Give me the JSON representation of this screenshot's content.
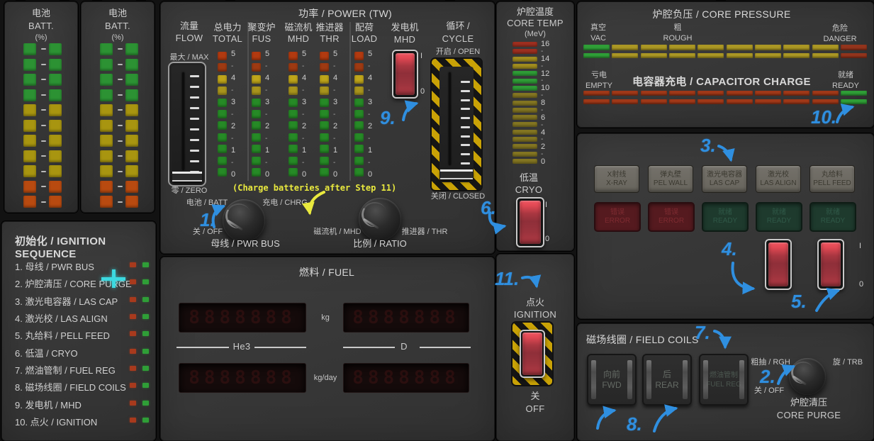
{
  "palette": {
    "g": "#2c9233",
    "y": "#a89510",
    "o": "#b84a10",
    "r1": "#b23a10",
    "r2": "#9e3a12",
    "y1": "#bfa51a",
    "y2": "#a8941c",
    "pg": "#268a26",
    "tr": "#a03020",
    "ty": "#a38f1f",
    "tg": "#2f9e37",
    "td": "#857722",
    "cg": "#2f9e37",
    "cy": "#ab9724",
    "cr": "#93341c",
    "qr": "#a03818",
    "qg": "#2f9e37"
  },
  "led_arrays": {
    "battery_column": [
      "g",
      "g",
      "g",
      "g",
      "y",
      "y",
      "y",
      "y",
      "y",
      "o",
      "o"
    ],
    "power_column": [
      "r1",
      "r2",
      "y1",
      "y2",
      "pg",
      "pg",
      "pg",
      "pg",
      "pg",
      "pg",
      "pg"
    ],
    "core_temp": [
      "tr",
      "tr",
      "ty",
      "ty",
      "tg",
      "tg",
      "tg",
      "td",
      "td",
      "td",
      "td",
      "td",
      "td",
      "td",
      "td",
      "td",
      "td"
    ],
    "pressure_row": [
      "cg",
      "cy",
      "cy",
      "cy",
      "cy",
      "cy",
      "cy",
      "cy",
      "cy",
      "cr"
    ],
    "capacitor_row": [
      "qr",
      "qr",
      "qr",
      "qr",
      "qr",
      "qr",
      "qr",
      "qr",
      "qr",
      "qg"
    ]
  },
  "battery": {
    "title_zh": "电池",
    "title_en": "BATT.",
    "title_pct": "(%)"
  },
  "sequence": {
    "title": "初始化 / IGNITION SEQUENCE",
    "items": [
      "1. 母线 / PWR BUS",
      "2. 炉腔清压 / CORE PURGE",
      "3. 激光电容器 / LAS CAP",
      "4. 激光校  / LAS ALIGN",
      "5. 丸给料 / PELL FEED",
      "6. 低温 / CRYO",
      "7. 燃油管制 / FUEL REG",
      "8. 磁场线圈 / FIELD COILS",
      "9. 发电机 / MHD",
      "10. 点火 / IGNITION"
    ]
  },
  "power": {
    "title": "功率 / POWER (TW)",
    "flow": {
      "zh": "流量",
      "en": "FLOW",
      "max": "最大 / MAX",
      "zero": "零 / ZERO"
    },
    "scale": [
      "5",
      "-",
      "4",
      "-",
      "3",
      "-",
      "2",
      "-",
      "1",
      "-",
      "0"
    ],
    "columns": [
      {
        "zh": "总电力",
        "en": "TOTAL"
      },
      {
        "zh": "聚变炉",
        "en": "FUS"
      },
      {
        "zh": "磁流机",
        "en": "MHD"
      },
      {
        "zh": "推进器",
        "en": "THR"
      },
      {
        "zh": "配荷",
        "en": "LOAD"
      }
    ],
    "gen": {
      "zh": "发电机",
      "en": "MHD",
      "on": "I",
      "off": "0"
    },
    "cycle": {
      "zh": "循环 /",
      "en": "CYCLE",
      "open": "开启 / OPEN",
      "closed": "关闭 / CLOSED"
    },
    "pwr_bus": {
      "batt": "电池 / BATT",
      "chrg": "充电 / CHRG",
      "off": "关 / OFF",
      "label": "母线 / PWR BUS"
    },
    "ratio": {
      "mhd": "磁流机 / MHD",
      "thr": "推进器 / THR",
      "label": "比例 / RATIO"
    }
  },
  "fuel": {
    "title": "燃料 / FUEL",
    "unit_top": "kg",
    "unit_bottom": "kg/day",
    "left": "He3",
    "right": "D",
    "display_ghost": "8888888"
  },
  "core_temp": {
    "zh": "炉腔温度",
    "en": "CORE TEMP",
    "unit": "(MeV)",
    "scale": [
      "16",
      "-",
      "14",
      "-",
      "12",
      "-",
      "10",
      "-",
      "8",
      "-",
      "6",
      "-",
      "4",
      "-",
      "2",
      "-",
      "0"
    ]
  },
  "cryo": {
    "zh": "低温",
    "en": "CRYO",
    "on": "I",
    "off": "0"
  },
  "ignition": {
    "zh": "点火",
    "en": "IGNITION",
    "off_zh": "关",
    "off_en": "OFF"
  },
  "pressure": {
    "title": "炉腔负压 / CORE PRESSURE",
    "vac_zh": "真空",
    "vac_en": "VAC",
    "rough_zh": "粗",
    "rough_en": "ROUGH",
    "danger_zh": "危险",
    "danger_en": "DANGER"
  },
  "capacitor": {
    "title": "电容器充电 / CAPACITOR CHARGE",
    "empty_zh": "亏电",
    "empty_en": "EMPTY",
    "ready_zh": "就绪",
    "ready_en": "READY"
  },
  "aux": {
    "buttons": [
      {
        "zh": "X射线",
        "en": "X-RAY"
      },
      {
        "zh": "弹丸壁",
        "en": "PEL WALL"
      },
      {
        "zh": "激光电容器",
        "en": "LAS CAP"
      },
      {
        "zh": "激光校",
        "en": "LAS ALIGN"
      },
      {
        "zh": "丸给料",
        "en": "PELL FEED"
      }
    ],
    "lamps": [
      {
        "zh": "错误",
        "en": "ERROR"
      },
      {
        "zh": "错误",
        "en": "ERROR"
      },
      {
        "zh": "就绪",
        "en": "READY"
      },
      {
        "zh": "就绪",
        "en": "READY"
      },
      {
        "zh": "就绪",
        "en": "READY"
      }
    ],
    "on": "I",
    "off": "0"
  },
  "field_coils": {
    "title": "磁场线圈 / FIELD COILS",
    "buttons": [
      {
        "zh": "向前",
        "en": "FWD"
      },
      {
        "zh": "后",
        "en": "REAR"
      },
      {
        "zh": "燃油管制",
        "en": "FUEL REG"
      }
    ],
    "purge": {
      "rgh": "粗抽 / RGH",
      "trb": "旋 / TRB",
      "off": "关 / OFF",
      "zh": "炉腔清压",
      "en": "CORE PURGE"
    }
  },
  "annotations": {
    "color": "#2f8fe0",
    "note": "(Charge batteries after Step 11)",
    "note_color": "#e9e93e",
    "steps": [
      "1.",
      "2.",
      "3.",
      "4.",
      "5.",
      "6.",
      "7.",
      "8.",
      "9.",
      "10.",
      "11."
    ]
  }
}
